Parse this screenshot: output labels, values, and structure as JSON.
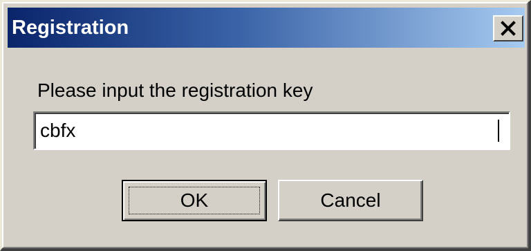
{
  "window": {
    "title": "Registration",
    "close_icon": "close-icon"
  },
  "form": {
    "prompt": "Please input the registration key",
    "key_value": "cbfx"
  },
  "buttons": {
    "ok_label": "OK",
    "cancel_label": "Cancel"
  },
  "colors": {
    "titlebar_start": "#0a246a",
    "titlebar_end": "#a6caf0",
    "dialog_face": "#d4d0c8"
  }
}
